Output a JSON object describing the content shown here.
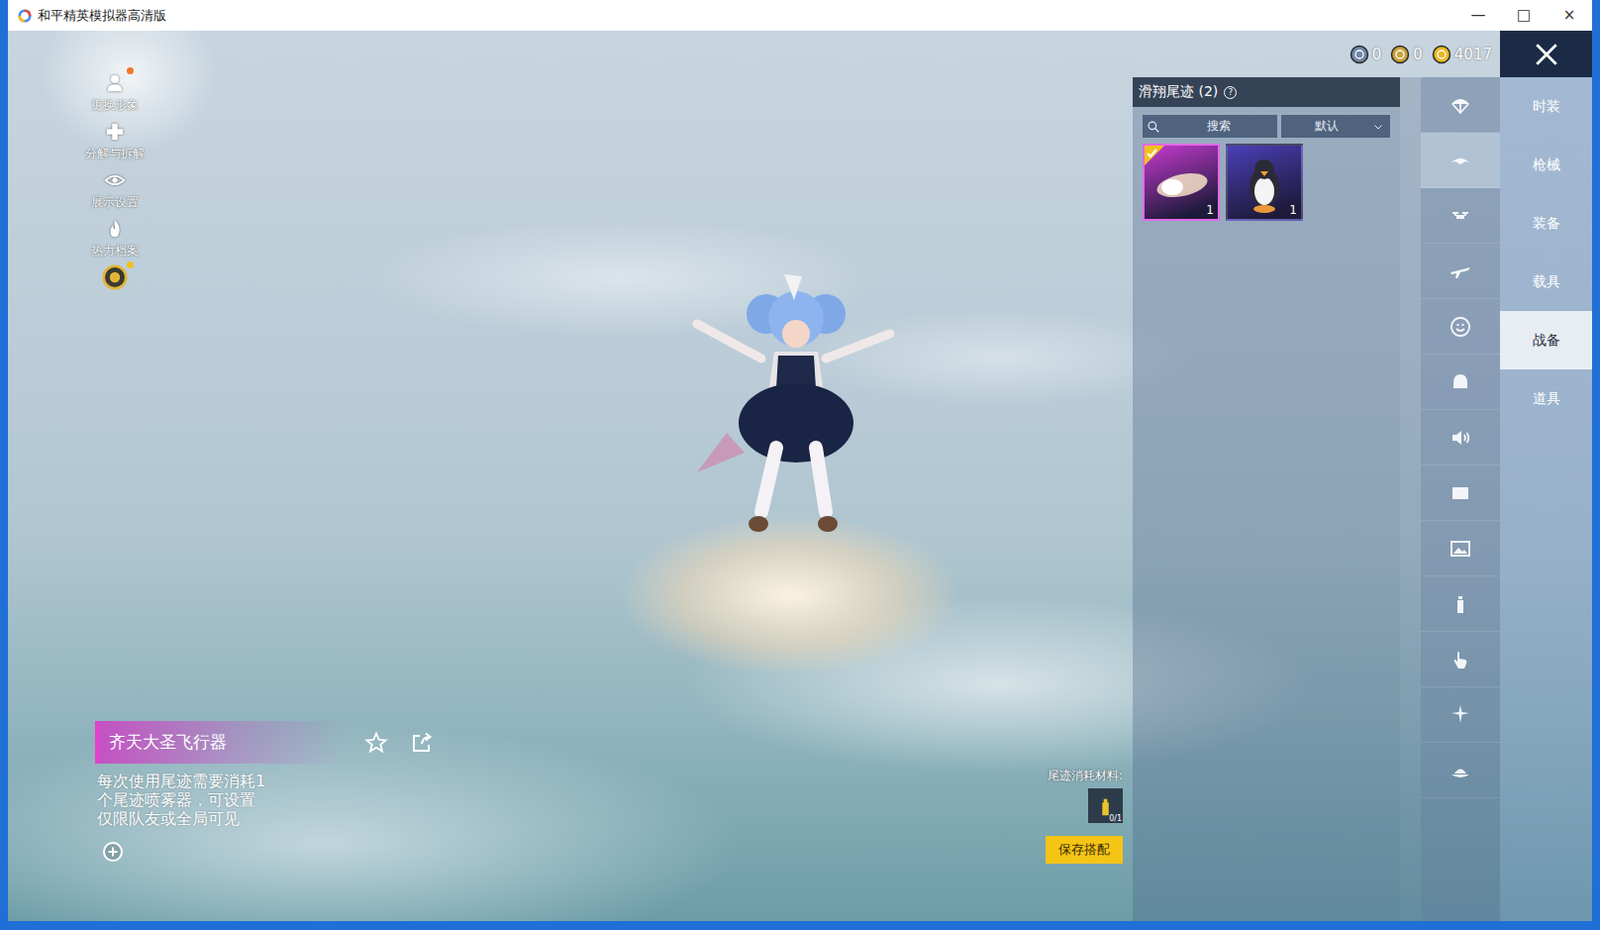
{
  "window": {
    "title": "和平精英模拟器高清版",
    "controls": [
      "—",
      "□",
      "×"
    ]
  },
  "currencies": [
    {
      "value": "0",
      "color": "#6f86a6"
    },
    {
      "value": "0",
      "color": "#c9a23a"
    },
    {
      "value": "4017",
      "color": "#e8b826"
    }
  ],
  "left_menu": [
    {
      "label": "更换形象",
      "badge": true
    },
    {
      "label": "分解与拆解",
      "badge": false
    },
    {
      "label": "展示设置",
      "badge": false
    },
    {
      "label": "热力档案",
      "badge": false
    }
  ],
  "rank_emblem": {
    "badge": true
  },
  "panel": {
    "title": "滑翔尾迹 (2)",
    "help": "?",
    "search": {
      "placeholder": "搜索"
    },
    "sort": {
      "value": "默认"
    },
    "items": [
      {
        "count": "1",
        "selected": true,
        "color": "#c53ad0"
      },
      {
        "count": "1",
        "selected": false,
        "color": "#4b3fb8"
      }
    ]
  },
  "icon_tabs": [
    {
      "selected": false
    },
    {
      "selected": true
    },
    {
      "selected": false
    },
    {
      "selected": false
    },
    {
      "selected": false
    },
    {
      "selected": false
    },
    {
      "selected": false
    },
    {
      "selected": false
    },
    {
      "selected": false
    },
    {
      "selected": false
    },
    {
      "selected": false
    },
    {
      "selected": false
    },
    {
      "selected": false
    }
  ],
  "categories": [
    {
      "label": "时装",
      "selected": false
    },
    {
      "label": "枪械",
      "selected": false
    },
    {
      "label": "装备",
      "selected": false
    },
    {
      "label": "载具",
      "selected": false
    },
    {
      "label": "战备",
      "selected": true
    },
    {
      "label": "道具",
      "selected": false
    }
  ],
  "item": {
    "name": "齐天大圣飞行器",
    "description": "每次使用尾迹需要消耗1个尾迹喷雾器，可设置仅限队友或全局可见",
    "favorited": false
  },
  "material": {
    "label": "尾迹消耗材料:",
    "count": "0/1"
  },
  "save_button": {
    "label": "保存搭配"
  }
}
